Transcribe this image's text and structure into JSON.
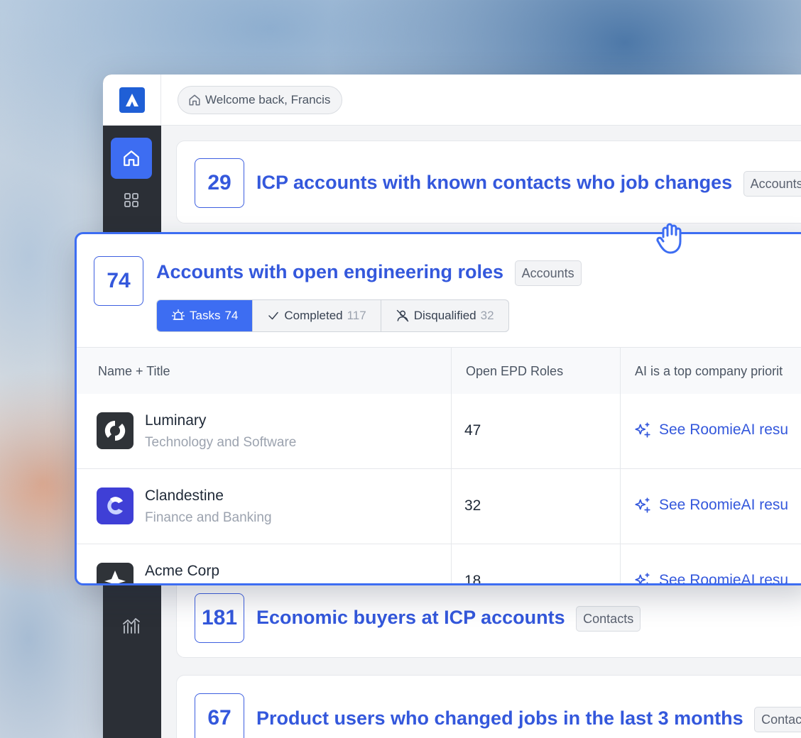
{
  "topbar": {
    "welcome": "Welcome back, Francis"
  },
  "lists": [
    {
      "count": "29",
      "title": "ICP accounts with known contacts who job changes",
      "tag": "Accounts"
    },
    {
      "count": "181",
      "title": "Economic buyers at ICP accounts",
      "tag": "Contacts"
    },
    {
      "count": "67",
      "title": "Product users who changed jobs in the last 3 months",
      "tag": "Contac"
    }
  ],
  "expanded": {
    "count": "74",
    "title": "Accounts with open engineering roles",
    "tag": "Accounts",
    "tabs": [
      {
        "label": "Tasks",
        "count": "74",
        "active": true
      },
      {
        "label": "Completed",
        "count": "117",
        "active": false
      },
      {
        "label": "Disqualified",
        "count": "32",
        "active": false
      }
    ],
    "columns": [
      "Name + Title",
      "Open EPD Roles",
      "AI is a top company priorit"
    ],
    "rows": [
      {
        "name": "Luminary",
        "industry": "Technology and Software",
        "roles": "47",
        "ai": "See RoomieAI resu"
      },
      {
        "name": "Clandestine",
        "industry": "Finance and Banking",
        "roles": "32",
        "ai": "See RoomieAI resu"
      },
      {
        "name": "Acme Corp",
        "industry": "",
        "roles": "18",
        "ai": "See RoomieAI resu"
      }
    ]
  },
  "colors": {
    "accent": "#3d6df2",
    "title_blue": "#3458dc",
    "sidebar": "#2b2f36"
  }
}
